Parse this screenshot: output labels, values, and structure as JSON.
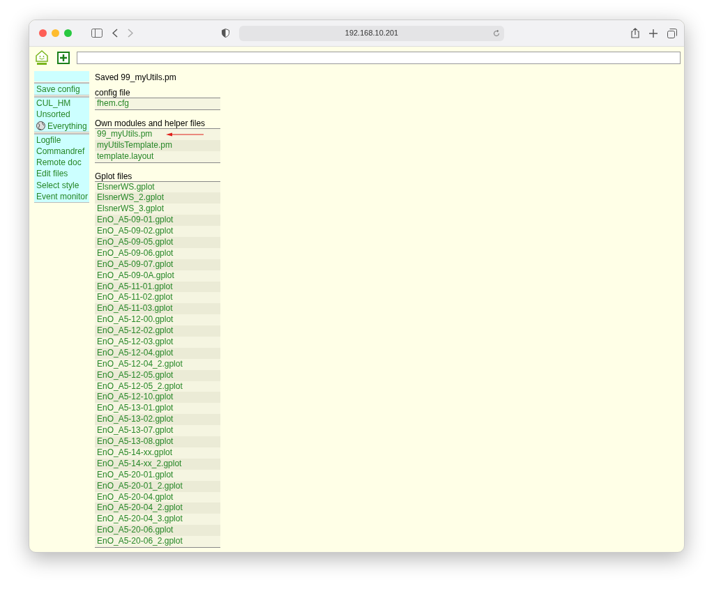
{
  "browser": {
    "address": "192.168.10.201"
  },
  "sidebar": {
    "groups": [
      {
        "items": [
          {
            "label": "Save config",
            "kind": "text"
          }
        ]
      },
      {
        "items": [
          {
            "label": "CUL_HM",
            "kind": "text"
          },
          {
            "label": "Unsorted",
            "kind": "text"
          },
          {
            "label": "Everything",
            "kind": "globe"
          }
        ]
      },
      {
        "items": [
          {
            "label": "Logfile",
            "kind": "text"
          },
          {
            "label": "Commandref",
            "kind": "text"
          },
          {
            "label": "Remote doc",
            "kind": "text"
          },
          {
            "label": "Edit files",
            "kind": "text"
          },
          {
            "label": "Select style",
            "kind": "text"
          },
          {
            "label": "Event monitor",
            "kind": "text"
          }
        ]
      }
    ]
  },
  "message": "Saved 99_myUtils.pm",
  "sections": [
    {
      "title": "config file",
      "files": [
        {
          "name": "fhem.cfg",
          "marked": false
        }
      ]
    },
    {
      "title": "Own modules and helper files",
      "files": [
        {
          "name": "99_myUtils.pm",
          "marked": true
        },
        {
          "name": "myUtilsTemplate.pm",
          "marked": false
        },
        {
          "name": "template.layout",
          "marked": false
        }
      ]
    },
    {
      "title": "Gplot files",
      "files": [
        {
          "name": "ElsnerWS.gplot",
          "marked": false
        },
        {
          "name": "ElsnerWS_2.gplot",
          "marked": false
        },
        {
          "name": "ElsnerWS_3.gplot",
          "marked": false
        },
        {
          "name": "EnO_A5-09-01.gplot",
          "marked": false
        },
        {
          "name": "EnO_A5-09-02.gplot",
          "marked": false
        },
        {
          "name": "EnO_A5-09-05.gplot",
          "marked": false
        },
        {
          "name": "EnO_A5-09-06.gplot",
          "marked": false
        },
        {
          "name": "EnO_A5-09-07.gplot",
          "marked": false
        },
        {
          "name": "EnO_A5-09-0A.gplot",
          "marked": false
        },
        {
          "name": "EnO_A5-11-01.gplot",
          "marked": false
        },
        {
          "name": "EnO_A5-11-02.gplot",
          "marked": false
        },
        {
          "name": "EnO_A5-11-03.gplot",
          "marked": false
        },
        {
          "name": "EnO_A5-12-00.gplot",
          "marked": false
        },
        {
          "name": "EnO_A5-12-02.gplot",
          "marked": false
        },
        {
          "name": "EnO_A5-12-03.gplot",
          "marked": false
        },
        {
          "name": "EnO_A5-12-04.gplot",
          "marked": false
        },
        {
          "name": "EnO_A5-12-04_2.gplot",
          "marked": false
        },
        {
          "name": "EnO_A5-12-05.gplot",
          "marked": false
        },
        {
          "name": "EnO_A5-12-05_2.gplot",
          "marked": false
        },
        {
          "name": "EnO_A5-12-10.gplot",
          "marked": false
        },
        {
          "name": "EnO_A5-13-01.gplot",
          "marked": false
        },
        {
          "name": "EnO_A5-13-02.gplot",
          "marked": false
        },
        {
          "name": "EnO_A5-13-07.gplot",
          "marked": false
        },
        {
          "name": "EnO_A5-13-08.gplot",
          "marked": false
        },
        {
          "name": "EnO_A5-14-xx.gplot",
          "marked": false
        },
        {
          "name": "EnO_A5-14-xx_2.gplot",
          "marked": false
        },
        {
          "name": "EnO_A5-20-01.gplot",
          "marked": false
        },
        {
          "name": "EnO_A5-20-01_2.gplot",
          "marked": false
        },
        {
          "name": "EnO_A5-20-04.gplot",
          "marked": false
        },
        {
          "name": "EnO_A5-20-04_2.gplot",
          "marked": false
        },
        {
          "name": "EnO_A5-20-04_3.gplot",
          "marked": false
        },
        {
          "name": "EnO_A5-20-06.gplot",
          "marked": false
        },
        {
          "name": "EnO_A5-20-06_2.gplot",
          "marked": false
        }
      ]
    }
  ]
}
